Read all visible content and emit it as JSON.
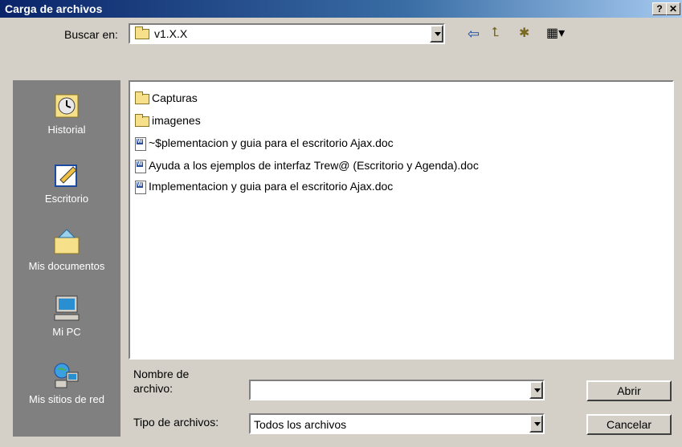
{
  "window": {
    "title": "Carga de archivos",
    "help_btn": "?",
    "close_btn": "✕"
  },
  "lookin": {
    "label": "Buscar en:",
    "value": "v1.X.X"
  },
  "toolbar": {
    "back": "⇦",
    "up": "⮤",
    "new_folder": "✱",
    "view": "▦▾"
  },
  "places": [
    {
      "label": "Historial",
      "icon": "history-icon"
    },
    {
      "label": "Escritorio",
      "icon": "desktop-icon"
    },
    {
      "label": "Mis documentos",
      "icon": "my-documents-icon"
    },
    {
      "label": "Mi PC",
      "icon": "my-computer-icon"
    },
    {
      "label": "Mis sitios de red",
      "icon": "network-places-icon"
    }
  ],
  "files": [
    {
      "name": "Capturas",
      "type": "folder"
    },
    {
      "name": "imagenes",
      "type": "folder"
    },
    {
      "name": "~$plementacion y guia para el escritorio Ajax.doc",
      "type": "doc"
    },
    {
      "name": "Ayuda a los ejemplos de interfaz Trew@ (Escritorio y Agenda).doc",
      "type": "doc"
    },
    {
      "name": "Implementacion y guia para el escritorio Ajax.doc",
      "type": "doc"
    }
  ],
  "filename": {
    "label1": "Nombre de",
    "label2": "archivo:",
    "value": ""
  },
  "filetype": {
    "label": "Tipo de archivos:",
    "value": "Todos los archivos"
  },
  "buttons": {
    "open": "Abrir",
    "cancel": "Cancelar"
  }
}
